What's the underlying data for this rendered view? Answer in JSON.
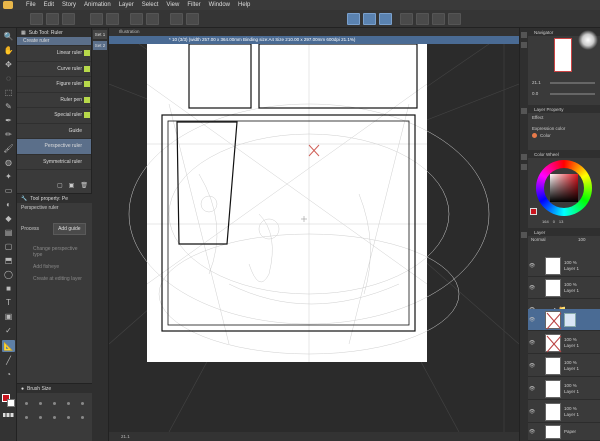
{
  "menu": [
    "File",
    "Edit",
    "Story",
    "Animation",
    "Layer",
    "Select",
    "View",
    "Filter",
    "Window",
    "Help"
  ],
  "subtool_panel": {
    "title": "Sub Tool: Ruler",
    "items": [
      "Create ruler",
      "Linear ruler",
      "Curve ruler",
      "Figure ruler",
      "Ruler pen",
      "Special ruler",
      "Guide",
      "Perspective ruler",
      "Symmetrical ruler"
    ],
    "selected_index": 7
  },
  "sets": [
    "Set 1",
    "Set 2"
  ],
  "tool_property": {
    "title": "Tool property: Pe",
    "tool_name": "Perspective ruler",
    "process_label": "Process",
    "process_value": "Add guide",
    "option_1": "Change perspective type",
    "option_2": "Add fisheye",
    "option_3": "Create at editing layer"
  },
  "brush_size": {
    "title": "Brush Size"
  },
  "canvas": {
    "tab_label": "Illustration",
    "title": "* 10 (3/3) (width 257.00 x 364.00mm Binding size:A4 Size 210.00 x 297.00mm 600dpi 21.1%)",
    "status": "21.1",
    "zoom": "21.1"
  },
  "right_panel": {
    "navigator_title": "Navigator",
    "nav_zoom": "21.1",
    "nav_angle": "0.0",
    "layer_property_title": "Layer Property",
    "effect_label": "Effect",
    "expression_color_label": "Expression color",
    "expression_color_value": "Color",
    "color_wheel_title": "Color Wheel",
    "color_values": [
      "164",
      "0",
      "13"
    ],
    "layer_title": "Layer",
    "blend_mode": "Normal",
    "layer_opacity": "100",
    "layers": [
      {
        "name": "Layer 1",
        "opacity": "100 %"
      },
      {
        "name": "Layer 1",
        "opacity": "100 %"
      },
      {
        "name": "Layer 1",
        "opacity": "100 %"
      },
      {
        "name": "Layer 1",
        "opacity": "100 %"
      },
      {
        "name": "Layer 1",
        "opacity": "100 %"
      },
      {
        "name": "Layer 1",
        "opacity": "100 %"
      },
      {
        "name": "Layer 1",
        "opacity": "100 %"
      },
      {
        "name": "Paper",
        "opacity": ""
      }
    ]
  },
  "colors": {
    "accent": "#4a6b94",
    "selected": "#5b6f8a",
    "ruler_swatch": "#b7d94a",
    "main_color": "#c8141e"
  }
}
